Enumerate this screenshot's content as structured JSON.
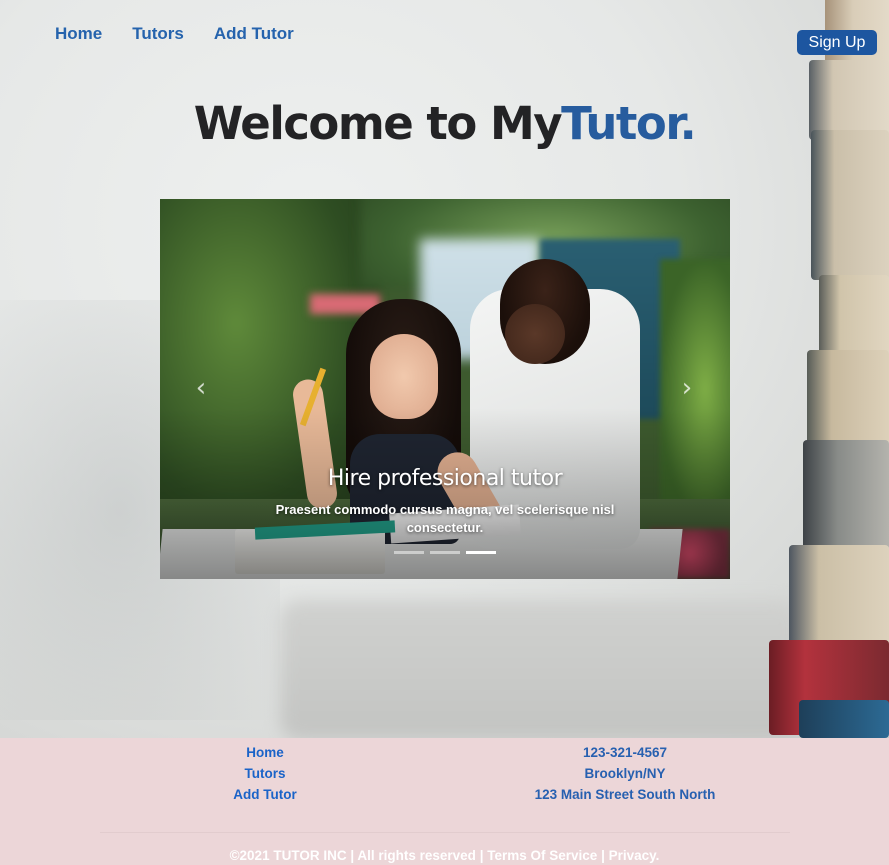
{
  "nav": {
    "items": [
      {
        "label": "Home"
      },
      {
        "label": "Tutors"
      },
      {
        "label": "Add Tutor"
      }
    ],
    "signup_label": "Sign Up"
  },
  "hero": {
    "welcome_prefix": "Welcome to My",
    "welcome_brand": "Tutor."
  },
  "carousel": {
    "slide_title": "Hire professional tutor",
    "slide_text": "Praesent commodo cursus magna, vel scelerisque nisl consectetur.",
    "prev_icon": "chevron-left-icon",
    "next_icon": "chevron-right-icon",
    "indicator_count": 3,
    "active_indicator": 3
  },
  "footer": {
    "links": [
      {
        "label": "Home"
      },
      {
        "label": "Tutors"
      },
      {
        "label": "Add Tutor"
      }
    ],
    "contact": {
      "phone": "123-321-4567",
      "city": "Brooklyn/NY",
      "address": "123 Main Street South North"
    },
    "copyright": "©2021 TUTOR INC",
    "rights": "All rights reserved",
    "terms": "Terms Of Service",
    "privacy": "Privacy.",
    "separator": "|"
  },
  "colors": {
    "brand_blue": "#275c9e",
    "signup_bg": "#1d56a0",
    "footer_bg": "#ecd6d8",
    "footer_link": "#1a63c8"
  }
}
